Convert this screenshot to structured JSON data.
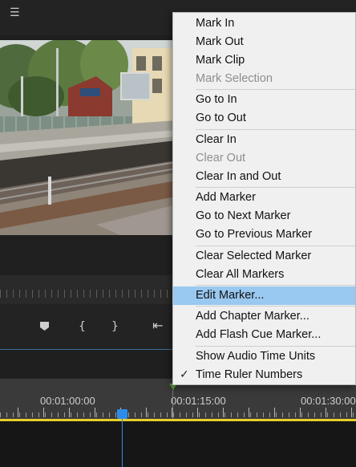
{
  "top_bar": {
    "menu_icon": "hamburger-icon",
    "menu_glyph": "☰"
  },
  "timeline": {
    "timecodes": [
      "00:01:00:00",
      "00:01:15:00",
      "00:01:30:00"
    ],
    "playhead_color": "#2d8ceb",
    "work_area_color": "#e6cf2a",
    "marker_color": "#5e9e3a"
  },
  "controls": {
    "icons": [
      "add-marker-icon",
      "mark-in-icon",
      "mark-out-icon",
      "go-to-in-icon"
    ],
    "glyphs": {
      "mark_in": "{",
      "mark_out": "}",
      "go_to_in": "⇤"
    }
  },
  "context_menu": {
    "highlight_color": "#99c8f0",
    "items": [
      {
        "label": "Mark In",
        "enabled": true
      },
      {
        "label": "Mark Out",
        "enabled": true
      },
      {
        "label": "Mark Clip",
        "enabled": true
      },
      {
        "label": "Mark Selection",
        "enabled": false
      },
      {
        "label": "Go to In",
        "enabled": true
      },
      {
        "label": "Go to Out",
        "enabled": true
      },
      {
        "label": "Clear In",
        "enabled": true
      },
      {
        "label": "Clear Out",
        "enabled": false
      },
      {
        "label": "Clear In and Out",
        "enabled": true
      },
      {
        "label": "Add Marker",
        "enabled": true
      },
      {
        "label": "Go to Next Marker",
        "enabled": true
      },
      {
        "label": "Go to Previous Marker",
        "enabled": true
      },
      {
        "label": "Clear Selected Marker",
        "enabled": true
      },
      {
        "label": "Clear All Markers",
        "enabled": true
      },
      {
        "label": "Edit Marker...",
        "enabled": true,
        "highlighted": true
      },
      {
        "label": "Add Chapter Marker...",
        "enabled": true
      },
      {
        "label": "Add Flash Cue Marker...",
        "enabled": true
      },
      {
        "label": "Show Audio Time Units",
        "enabled": true
      },
      {
        "label": "Time Ruler Numbers",
        "enabled": true,
        "checked": true
      }
    ],
    "check_glyph": "✓"
  }
}
